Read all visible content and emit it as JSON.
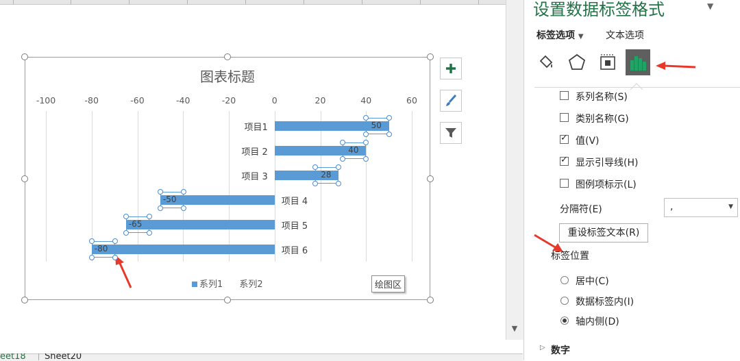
{
  "chart": {
    "title": "图表标题",
    "plot_tooltip": "绘图区",
    "legend": [
      {
        "label": "系列1",
        "color": "#5b9bd5"
      },
      {
        "label": "系列2"
      }
    ]
  },
  "chart_data": {
    "type": "bar",
    "orientation": "horizontal",
    "title": "图表标题",
    "categories": [
      "项目1",
      "项目 2",
      "项目 3",
      "项目 4",
      "项目 5",
      "项目 6"
    ],
    "series": [
      {
        "name": "系列1",
        "values": [
          50,
          40,
          28,
          -50,
          -65,
          -80
        ],
        "color": "#5b9bd5"
      },
      {
        "name": "系列2",
        "values": []
      }
    ],
    "xlim": [
      -100,
      60
    ],
    "xticks": [
      "-100",
      "-80",
      "-60",
      "-40",
      "-20",
      "0",
      "20",
      "40",
      "60"
    ],
    "data_labels": [
      "50",
      "40",
      "28",
      "-50",
      "-65",
      "-80"
    ],
    "axis_position": "top",
    "grid": true,
    "legend_position": "bottom"
  },
  "chart_side_buttons": [
    {
      "name": "chart-elements-button",
      "icon": "plus-icon"
    },
    {
      "name": "chart-styles-button",
      "icon": "paintbrush-icon"
    },
    {
      "name": "chart-filters-button",
      "icon": "funnel-icon"
    }
  ],
  "sheets": {
    "tabs": [
      "eet18",
      "Sheet20"
    ]
  },
  "pane": {
    "title": "设置数据标签格式",
    "tabs": [
      "标签选项",
      "文本选项"
    ],
    "icons": [
      "fill-bucket-icon",
      "pentagon-icon",
      "size-properties-icon",
      "bar-chart-icon"
    ],
    "checkboxes": [
      {
        "label": "系列名称(S)",
        "checked": false
      },
      {
        "label": "类别名称(G)",
        "checked": false
      },
      {
        "label": "值(V)",
        "checked": true
      },
      {
        "label": "显示引导线(H)",
        "checked": true
      },
      {
        "label": "图例项标示(L)",
        "checked": false
      }
    ],
    "separator_label": "分隔符(E)",
    "separator_value": ",",
    "reset_button": "重设标签文本(R)",
    "position_heading": "标签位置",
    "positions": [
      {
        "label": "居中(C)",
        "selected": false
      },
      {
        "label": "数据标签内(I)",
        "selected": false
      },
      {
        "label": "轴内侧(D)",
        "selected": true
      }
    ],
    "number_section": "数字",
    "accent_color": "#217346",
    "annotation_arrow_color": "#e8382a"
  }
}
